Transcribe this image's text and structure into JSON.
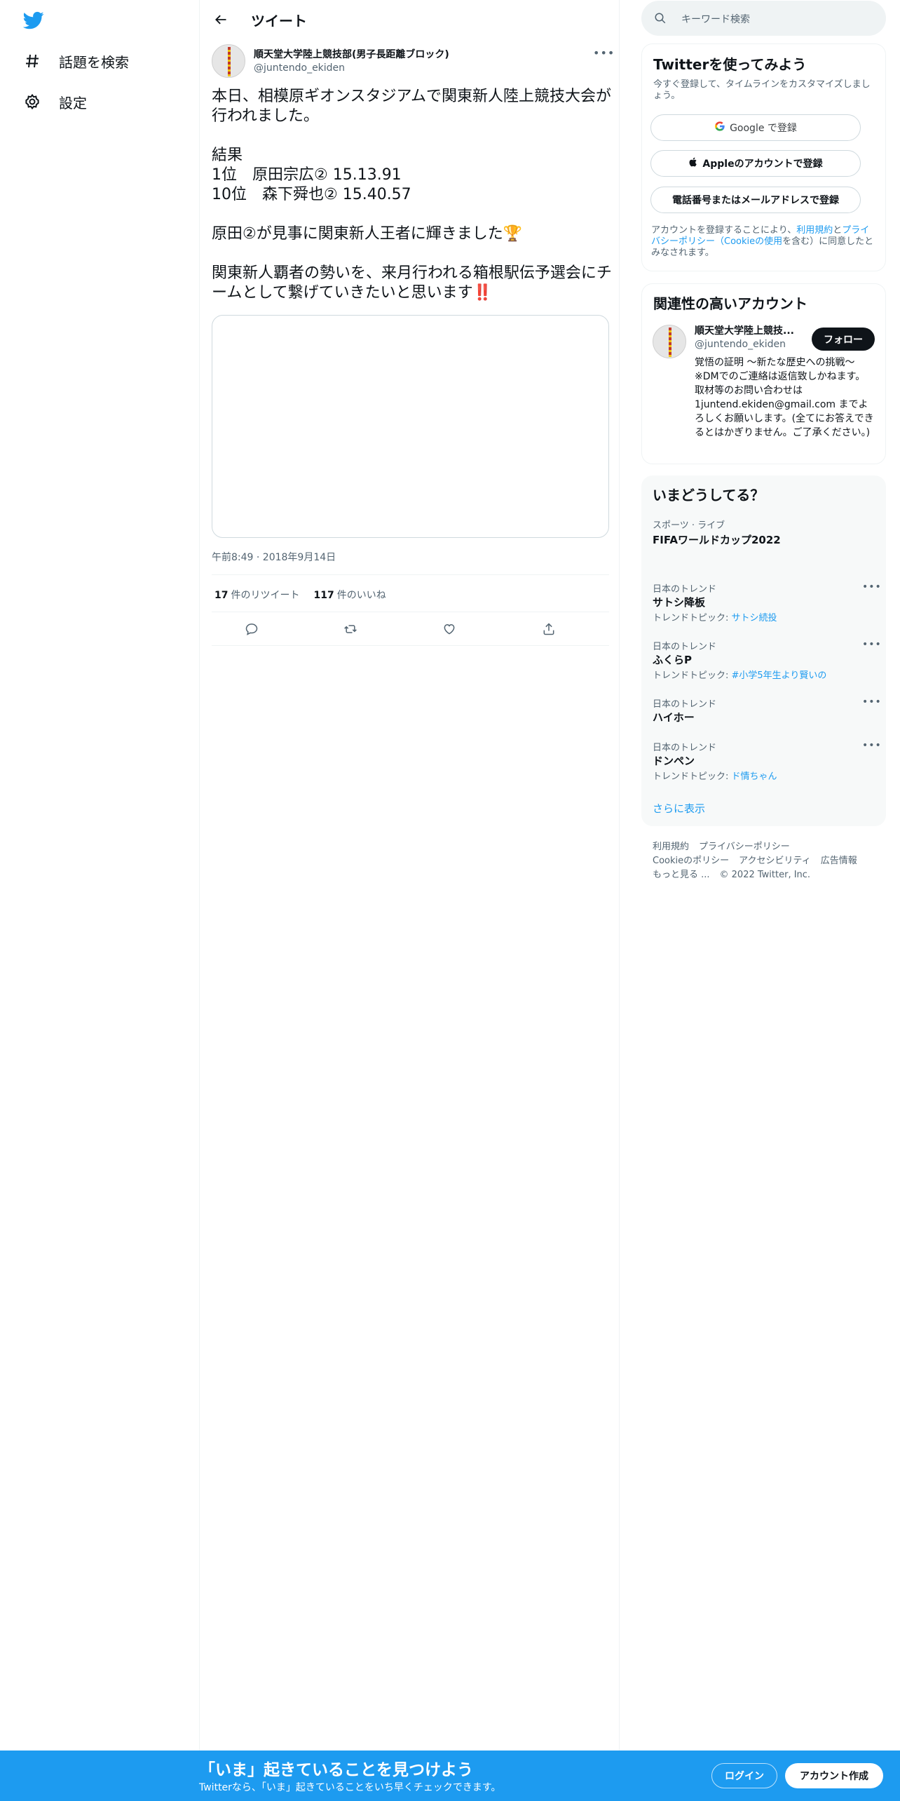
{
  "nav": {
    "logo": "twitter-bird-icon",
    "items": [
      {
        "icon": "hashtag-icon",
        "label": "話題を検索"
      },
      {
        "icon": "gear-icon",
        "label": "設定"
      }
    ]
  },
  "header": {
    "title": "ツイート"
  },
  "tweet": {
    "author_name": "順天堂大学陸上競技部(男子長距離ブロック)",
    "author_handle": "@juntendo_ekiden",
    "text": "本日、相模原ギオンスタジアムで関東新人陸上競技大会が行われました。\n\n結果\n1位　原田宗広② 15.13.91\n10位　森下舜也② 15.40.57\n\n原田②が見事に関東新人王者に輝きました🏆\n\n関東新人覇者の勢いを、来月行われる箱根駅伝予選会にチームとして繋げていきたいと思います‼️",
    "timestamp": "午前8:49 · 2018年9月14日",
    "retweets_count": "17",
    "retweets_label": "件のリツイート",
    "likes_count": "117",
    "likes_label": "件のいいね"
  },
  "sidebar": {
    "search_placeholder": "キーワード検索",
    "signup": {
      "title": "Twitterを使ってみよう",
      "subtitle": "今すぐ登録して、タイムラインをカスタマイズしましょう。",
      "google_label": "Google で登録",
      "apple_label": "Appleのアカウントで登録",
      "phone_label": "電話番号またはメールアドレスで登録",
      "legal_prefix": "アカウントを登録することにより、",
      "legal_terms": "利用規約",
      "legal_and": "と",
      "legal_privacy": "プライバシーポリシー（Cookieの使用",
      "legal_suffix": "を含む）に同意したとみなされます。"
    },
    "related": {
      "title": "関連性の高いアカウント",
      "name": "順天堂大学陸上競技...",
      "handle": "@juntendo_ekiden",
      "follow_label": "フォロー",
      "bio": "覚悟の証明 〜新たな歴史への挑戦〜 ※DMでのご連絡は返信致しかねます。 取材等のお問い合わせは 1juntend.ekiden@gmail.com までよろしくお願いします。(全てにお答えできるとはかぎりません。ご了承ください。)"
    },
    "trends": {
      "title": "いまどうしてる？",
      "items": [
        {
          "category": "スポーツ · ライブ",
          "title": "FIFAワールドカップ2022",
          "topic_prefix": "",
          "topic": ""
        },
        {
          "category": "日本のトレンド",
          "title": "サトシ降板",
          "topic_prefix": "トレンドトピック: ",
          "topic": "サトシ続投"
        },
        {
          "category": "日本のトレンド",
          "title": "ふくらP",
          "topic_prefix": "トレンドトピック: ",
          "topic": "#小学5年生より賢いの"
        },
        {
          "category": "日本のトレンド",
          "title": "ハイホー",
          "topic_prefix": "",
          "topic": ""
        },
        {
          "category": "日本のトレンド",
          "title": "ドンペン",
          "topic_prefix": "トレンドトピック: ",
          "topic": "ド情ちゃん"
        }
      ],
      "show_more": "さらに表示"
    },
    "footer": {
      "line1": [
        "利用規約",
        "プライバシーポリシー"
      ],
      "line2": [
        "Cookieのポリシー",
        "アクセシビリティ",
        "広告情報"
      ],
      "line3": [
        "もっと見る ...",
        "© 2022 Twitter, Inc."
      ]
    }
  },
  "banner": {
    "title": "「いま」起きていることを見つけよう",
    "subtitle": "Twitterなら、「いま」起きていることをいち早くチェックできます。",
    "login_label": "ログイン",
    "signup_label": "アカウント作成"
  },
  "colors": {
    "accent": "#1d9bf0",
    "text": "#0f1419",
    "secondary": "#536471"
  }
}
